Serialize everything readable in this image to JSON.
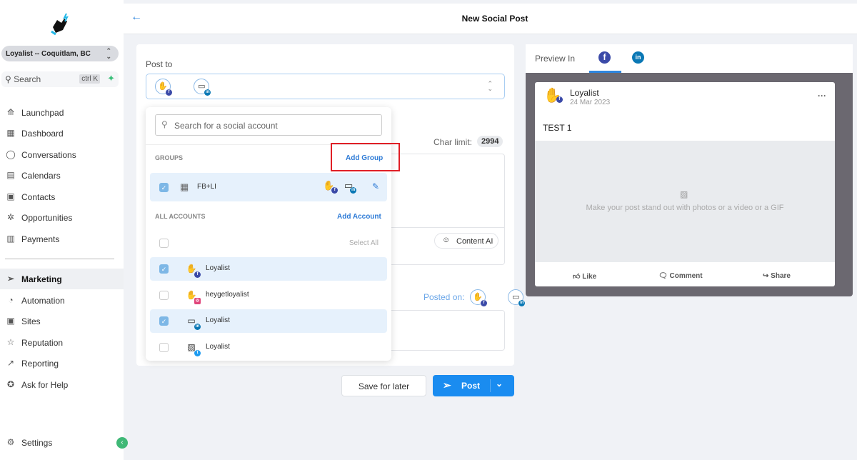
{
  "sidebar": {
    "location": "Loyalist -- Coquitlam, BC",
    "search_label": "Search",
    "search_shortcut": "ctrl K",
    "items": [
      {
        "label": "Launchpad",
        "icon": "rocket-icon"
      },
      {
        "label": "Dashboard",
        "icon": "grid-icon"
      },
      {
        "label": "Conversations",
        "icon": "chat-icon"
      },
      {
        "label": "Calendars",
        "icon": "calendar-icon"
      },
      {
        "label": "Contacts",
        "icon": "contacts-icon"
      },
      {
        "label": "Opportunities",
        "icon": "opportunities-icon"
      },
      {
        "label": "Payments",
        "icon": "payments-icon"
      },
      {
        "label": "Marketing",
        "icon": "send-icon",
        "active": true
      },
      {
        "label": "Automation",
        "icon": "automation-icon"
      },
      {
        "label": "Sites",
        "icon": "sites-icon"
      },
      {
        "label": "Reputation",
        "icon": "star-icon"
      },
      {
        "label": "Reporting",
        "icon": "chart-icon"
      },
      {
        "label": "Ask for Help",
        "icon": "help-icon"
      }
    ],
    "settings": "Settings"
  },
  "header": {
    "title": "New Social Post"
  },
  "composer": {
    "post_to_label": "Post to",
    "char_limit_label": "Char limit:",
    "char_limit": "2994",
    "content_ai": "Content AI",
    "posted_on": "Posted on:"
  },
  "dropdown": {
    "search_placeholder": "Search for a social account",
    "groups_label": "GROUPS",
    "add_group": "Add Group",
    "groups": [
      {
        "name": "FB+LI",
        "checked": true
      }
    ],
    "all_accounts_label": "ALL ACCOUNTS",
    "add_account": "Add Account",
    "select_all": "Select All",
    "accounts": [
      {
        "name": "Loyalist",
        "network": "facebook",
        "checked": true
      },
      {
        "name": "heygetloyalist",
        "network": "instagram",
        "checked": false
      },
      {
        "name": "Loyalist",
        "network": "linkedin",
        "checked": true
      },
      {
        "name": "Loyalist",
        "network": "twitter",
        "checked": false
      }
    ]
  },
  "actions": {
    "save_later": "Save for later",
    "post": "Post"
  },
  "preview": {
    "label": "Preview In",
    "tabs": [
      "facebook",
      "linkedin"
    ],
    "active_tab": "facebook",
    "account": "Loyalist",
    "date": "24 Mar 2023",
    "text": "TEST 1",
    "media_placeholder": "Make your post stand out with photos or a video or a GIF",
    "like": "Like",
    "comment": "Comment",
    "share": "Share"
  },
  "colors": {
    "accent": "#1a8cf0",
    "highlight": "#e01f26",
    "facebook": "#3b4aa8",
    "linkedin": "#0a78b5"
  }
}
